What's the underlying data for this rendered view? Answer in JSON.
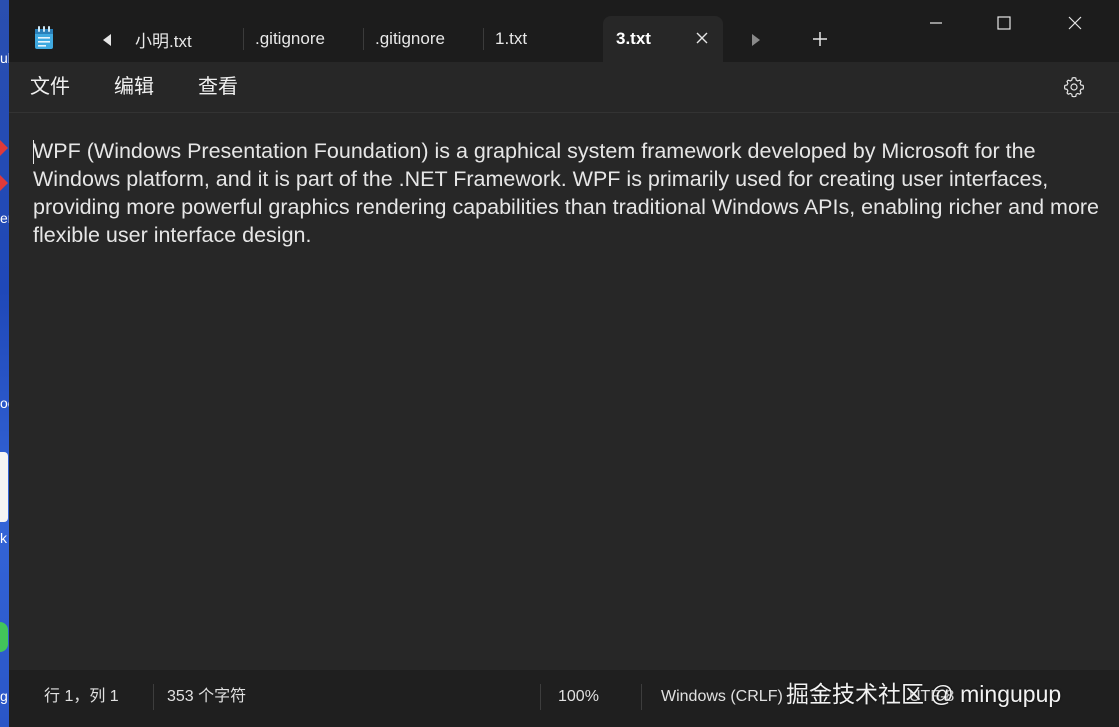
{
  "desktop": {
    "fragments": [
      "ub",
      "er",
      "oc",
      "k",
      "g"
    ]
  },
  "tabs": {
    "items": [
      {
        "label": "小明.txt"
      },
      {
        "label": ".gitignore"
      },
      {
        "label": ".gitignore"
      },
      {
        "label": "1.txt"
      },
      {
        "label": "3.txt"
      }
    ],
    "active_index": 4
  },
  "menu": {
    "file": "文件",
    "edit": "编辑",
    "view": "查看"
  },
  "editor": {
    "content": "WPF (Windows Presentation Foundation) is a graphical system framework developed by Microsoft for the Windows platform, and it is part of the .NET Framework. WPF is primarily used for creating user interfaces, providing more powerful graphics rendering capabilities than traditional Windows APIs, enabling richer and more flexible user interface design."
  },
  "status": {
    "position": "行 1，列 1",
    "char_count": "353 个字符",
    "zoom": "100%",
    "line_ending": "Windows (CRLF)",
    "encoding": "UTF-8"
  },
  "watermark": "掘金技术社区 @ mingupup",
  "colors": {
    "window_bg": "#272727",
    "titlebar_bg": "#1c1c1c",
    "statusbar_bg": "#1f1f1f",
    "text": "#e6e6e6"
  },
  "icons": {
    "app": "notepad-icon",
    "scroll_left": "caret-left-icon",
    "scroll_right": "caret-right-icon",
    "close_tab": "close-icon",
    "new_tab": "plus-icon",
    "minimize": "minimize-icon",
    "maximize": "maximize-icon",
    "close_window": "close-window-icon",
    "settings": "gear-icon"
  }
}
